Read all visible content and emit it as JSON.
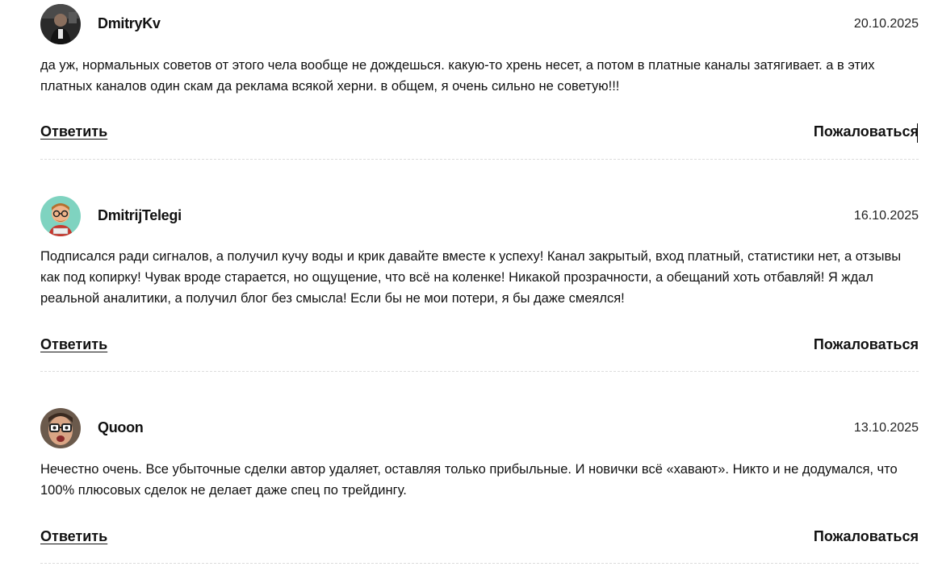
{
  "comments": [
    {
      "author": "DmitryKv",
      "avatar_icon": "user-photo-dark-icon",
      "date": "20.10.2025",
      "text": "да уж, нормальных советов от этого чела вообще не дождешься. какую-то хрень несет, а потом в платные каналы затягивает. а в этих платных каналов один скам да реклама всякой херни. в общем, я очень сильно не советую!!!",
      "reply_label": "Ответить",
      "report_label": "Пожаловаться"
    },
    {
      "author": "DmitrijTelegi",
      "avatar_icon": "cartoon-man-avatar-icon",
      "date": "16.10.2025",
      "text": "Подписался ради сигналов, а получил кучу воды и крик давайте вместе к успеху! Канал закрытый, вход платный, статистики нет, а отзывы как под копирку! Чувак вроде старается, но ощущение, что всё на коленке! Никакой прозрачности, а обещаний хоть отбавляй! Я ждал реальной аналитики, а получил блог без смысла! Если бы не мои потери, я бы даже смеялся!",
      "reply_label": "Ответить",
      "report_label": "Пожаловаться"
    },
    {
      "author": "Quoon",
      "avatar_icon": "man-with-glasses-avatar-icon",
      "date": "13.10.2025",
      "text": "Нечестно очень. Все убыточные сделки автор удаляет, оставляя только прибыльные. И новички всё «хавают». Никто и не додумался, что 100% плюсовых сделок не делает даже спец по трейдингу.",
      "reply_label": "Ответить",
      "report_label": "Пожаловаться"
    }
  ]
}
